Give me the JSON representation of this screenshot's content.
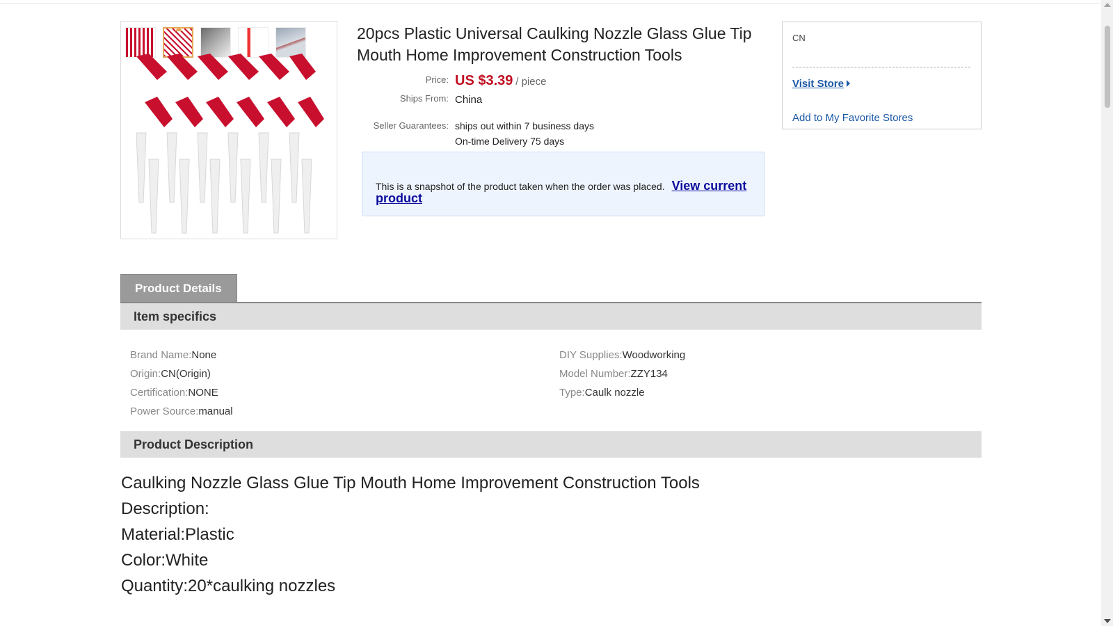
{
  "gallery": {
    "thumbnails": [
      "thumbnail-1",
      "thumbnail-2",
      "thumbnail-3",
      "thumbnail-4",
      "thumbnail-5"
    ],
    "active_index": 1
  },
  "product": {
    "title": "20pcs Plastic Universal Caulking Nozzle Glass Glue Tip Mouth Home Improvement Construction Tools",
    "price_label": "Price:",
    "price": "US $3.39",
    "price_unit": "/ piece",
    "ships_from_label": "Ships From:",
    "ships_from": "China",
    "guarantees_label": "Seller Guarantees:",
    "guarantee_1": "ships out within 7 business days",
    "guarantee_2": "On-time Delivery 75 days"
  },
  "snapshot": {
    "text": "This is a snapshot of the product taken when the order was placed.",
    "link": "View current product"
  },
  "store": {
    "country": "CN",
    "visit": "Visit Store",
    "favorite": "Add to My Favorite Stores"
  },
  "tabs": {
    "product_details": "Product Details"
  },
  "item_specifics": {
    "heading": "Item specifics",
    "left": [
      {
        "key": "Brand Name:",
        "value": "None"
      },
      {
        "key": "Origin:",
        "value": "CN(Origin)"
      },
      {
        "key": "Certification:",
        "value": "NONE"
      },
      {
        "key": "Power Source:",
        "value": "manual"
      }
    ],
    "right": [
      {
        "key": "DIY Supplies:",
        "value": "Woodworking"
      },
      {
        "key": "Model Number:",
        "value": "ZZY134"
      },
      {
        "key": "Type:",
        "value": "Caulk nozzle"
      }
    ]
  },
  "description": {
    "heading": "Product Description",
    "lines": [
      "Caulking Nozzle Glass Glue Tip Mouth Home Improvement Construction Tools",
      "Description:",
      "Material:Plastic",
      "Color:White",
      "Quantity:20*caulking nozzles"
    ]
  },
  "colors": {
    "price": "#c10f21",
    "link": "#1c58a5",
    "nozzle_red": "#c8102e"
  }
}
